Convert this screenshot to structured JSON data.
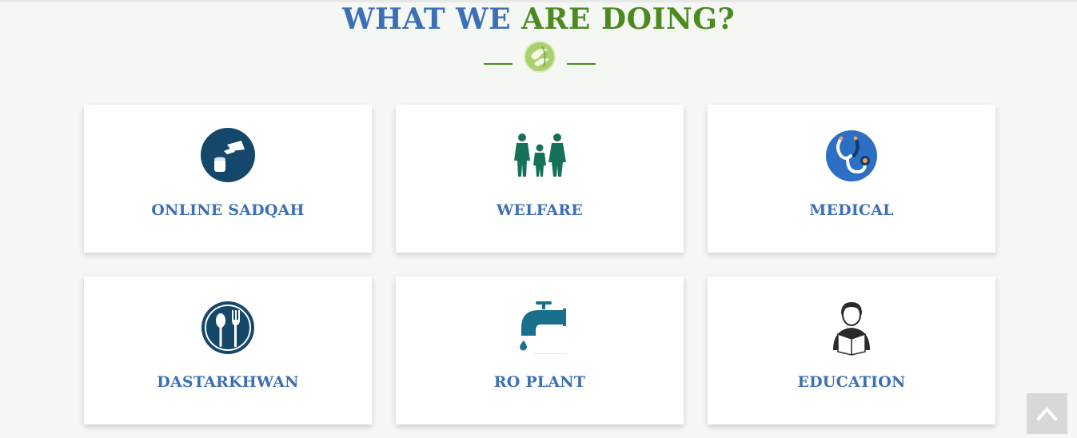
{
  "section": {
    "title_part1": "WHAT WE ",
    "title_part2": "ARE DOING?",
    "title_color_primary": "#3b6fb6",
    "title_color_accent": "#4c8a1f",
    "divider_icon": "leaf-logo-icon"
  },
  "cards": [
    {
      "label": "ONLINE SADQAH",
      "icon": "donation-hand-icon"
    },
    {
      "label": "WELFARE",
      "icon": "family-icon"
    },
    {
      "label": "MEDICAL",
      "icon": "stethoscope-icon"
    },
    {
      "label": "DASTARKHWAN",
      "icon": "spoon-fork-icon"
    },
    {
      "label": "RO PLANT",
      "icon": "water-tap-icon"
    },
    {
      "label": "EDUCATION",
      "icon": "student-reading-icon"
    }
  ],
  "scroll_top": {
    "icon": "chevron-up-icon"
  }
}
